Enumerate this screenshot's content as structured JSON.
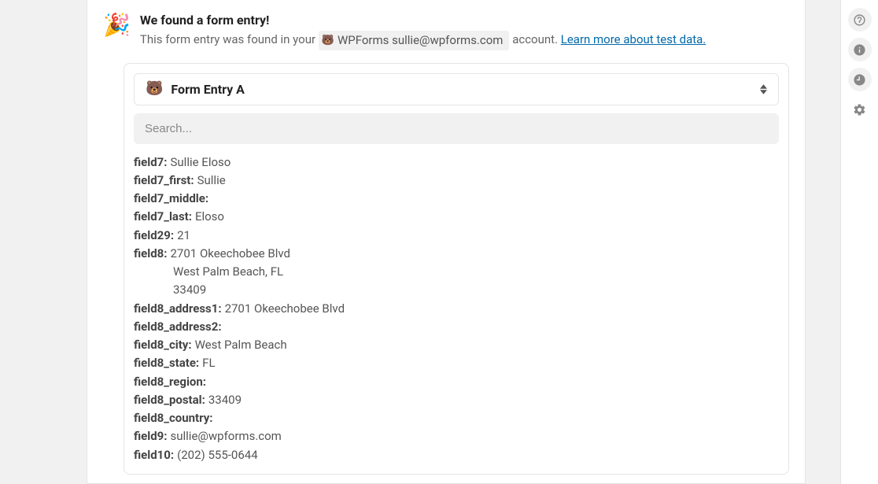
{
  "header": {
    "title": "We found a form entry!",
    "subtitle_prefix": "This form entry was found in your ",
    "account_label": "WPForms sullie@wpforms.com",
    "subtitle_suffix": " account. ",
    "learn_more": "Learn more about test data."
  },
  "entry": {
    "selector_label": "Form Entry A",
    "search_placeholder": "Search..."
  },
  "fields": [
    {
      "key": "field7:",
      "value": "Sullie Eloso"
    },
    {
      "key": "field7_first:",
      "value": "Sullie"
    },
    {
      "key": "field7_middle:",
      "value": ""
    },
    {
      "key": "field7_last:",
      "value": "Eloso"
    },
    {
      "key": "field29:",
      "value": "21"
    },
    {
      "key": "field8:",
      "value": "2701 Okeechobee Blvd",
      "extra": [
        "West Palm Beach, FL",
        "33409"
      ]
    },
    {
      "key": "field8_address1:",
      "value": "2701 Okeechobee Blvd"
    },
    {
      "key": "field8_address2:",
      "value": ""
    },
    {
      "key": "field8_city:",
      "value": "West Palm Beach"
    },
    {
      "key": "field8_state:",
      "value": "FL"
    },
    {
      "key": "field8_region:",
      "value": ""
    },
    {
      "key": "field8_postal:",
      "value": "33409"
    },
    {
      "key": "field8_country:",
      "value": ""
    },
    {
      "key": "field9:",
      "value": "sullie@wpforms.com"
    },
    {
      "key": "field10:",
      "value": "(202) 555-0644"
    }
  ]
}
